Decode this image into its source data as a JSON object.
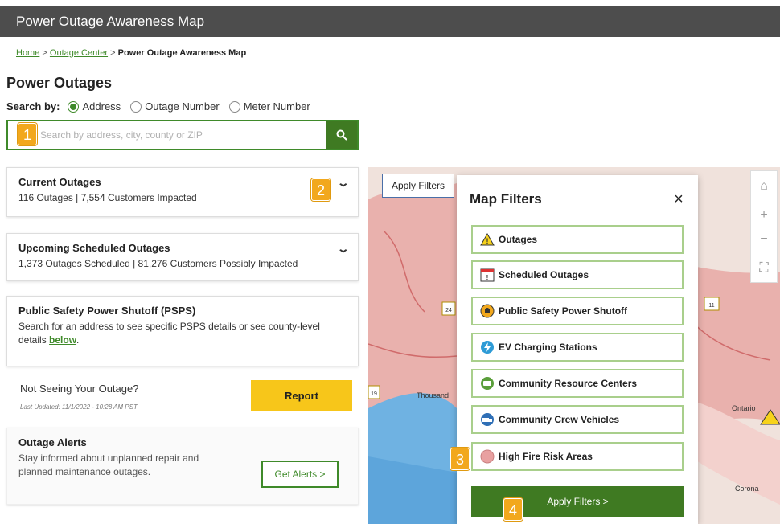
{
  "header": {
    "title": "Power Outage Awareness Map"
  },
  "breadcrumb": {
    "home": "Home",
    "sep1": ">",
    "outage_center": "Outage Center",
    "sep2": ">",
    "current": "Power Outage Awareness Map"
  },
  "page": {
    "title": "Power Outages"
  },
  "search": {
    "by_label": "Search by:",
    "options": [
      "Address",
      "Outage Number",
      "Meter Number"
    ],
    "selected": "Address",
    "placeholder": "Search by address, city, county or ZIP"
  },
  "badges": [
    "1",
    "2",
    "3",
    "4"
  ],
  "current_outages": {
    "title": "Current Outages",
    "summary": "116 Outages | 7,554 Customers Impacted"
  },
  "upcoming_outages": {
    "title": "Upcoming Scheduled Outages",
    "summary": "1,373 Outages Scheduled | 81,276 Customers Possibly Impacted"
  },
  "psps": {
    "title": "Public Safety Power Shutoff (PSPS)",
    "text": "Search for an address to see specific PSPS details or see county-level details ",
    "link": "below",
    "suffix": "."
  },
  "report": {
    "heading": "Not Seeing Your Outage?",
    "updated": "Last Updated: 11/1/2022 - 10:28 AM PST",
    "button": "Report"
  },
  "alerts": {
    "title": "Outage Alerts",
    "text": "Stay informed about unplanned repair and planned maintenance outages.",
    "button": "Get Alerts >"
  },
  "map": {
    "apply_tab": "Apply Filters",
    "labels": [
      "Thousand",
      "Ontario",
      "Corona"
    ],
    "route_markers": [
      "24",
      "11",
      "19"
    ]
  },
  "filters": {
    "title": "Map Filters",
    "close": "×",
    "options": [
      {
        "label": "Outages",
        "icon": "warning-triangle-icon"
      },
      {
        "label": "Scheduled Outages",
        "icon": "calendar-icon"
      },
      {
        "label": "Public Safety Power Shutoff",
        "icon": "bell-icon"
      },
      {
        "label": "EV Charging Stations",
        "icon": "lightning-icon"
      },
      {
        "label": "Community Resource Centers",
        "icon": "bus-icon"
      },
      {
        "label": "Community Crew Vehicles",
        "icon": "truck-icon"
      },
      {
        "label": "High Fire Risk Areas",
        "icon": "fire-area-icon"
      }
    ],
    "apply_button": "Apply Filters >"
  },
  "colors": {
    "header_bg": "#4d4d4d",
    "brand_green": "#3f7a22",
    "accent_yellow": "#f7c61a",
    "badge_orange": "#f2a81d",
    "fire_area": "#e8a0a0",
    "water": "#7fb8e3"
  }
}
